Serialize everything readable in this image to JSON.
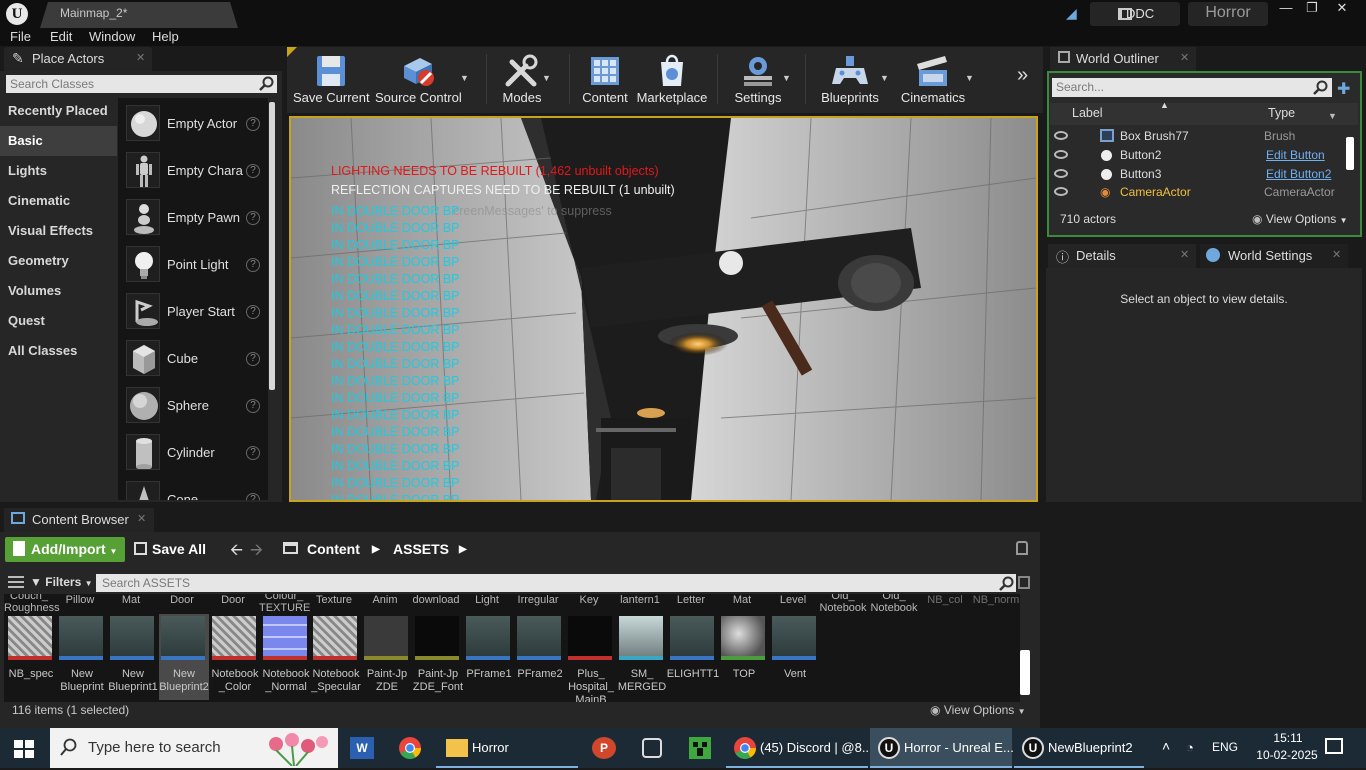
{
  "window": {
    "tab_title": "Mainmap_2*",
    "project_name": "Horror",
    "ddc_label": "DDC",
    "logo_letter": "U"
  },
  "menu": [
    "File",
    "Edit",
    "Window",
    "Help"
  ],
  "place_actors": {
    "tab_label": "Place Actors",
    "search_placeholder": "Search Classes",
    "categories": [
      "Recently Placed",
      "Basic",
      "Lights",
      "Cinematic",
      "Visual Effects",
      "Geometry",
      "Volumes",
      "Quest",
      "All Classes"
    ],
    "selected_category": "Basic",
    "actors": [
      "Empty Actor",
      "Empty Chara",
      "Empty Pawn",
      "Point Light",
      "Player Start",
      "Cube",
      "Sphere",
      "Cylinder",
      "Cone"
    ]
  },
  "toolbar": {
    "buttons": [
      {
        "label": "Save Current",
        "icon": "save-icon"
      },
      {
        "label": "Source Control",
        "icon": "source-control-icon"
      },
      {
        "label": "Modes",
        "icon": "modes-icon"
      },
      {
        "label": "Content",
        "icon": "content-icon"
      },
      {
        "label": "Marketplace",
        "icon": "marketplace-icon"
      },
      {
        "label": "Settings",
        "icon": "settings-icon"
      },
      {
        "label": "Blueprints",
        "icon": "blueprints-icon"
      },
      {
        "label": "Cinematics",
        "icon": "cinematics-icon"
      }
    ]
  },
  "viewport": {
    "lighting_warning": "LIGHTING NEEDS TO BE REBUILT (1,462 unbuilt objects)",
    "reflection_warning": "REFLECTION CAPTURES NEED TO BE REBUILT (1 unbuilt)",
    "ghost_text": "creenMessages' to suppress",
    "debug_message": "IN DOUBLE DOOR BP",
    "debug_count": 18,
    "warning_color": "#e0191b",
    "debug_color": "#1ecbe1",
    "border_color": "#c8a41b"
  },
  "world_outliner": {
    "tab_label": "World Outliner",
    "search_placeholder": "Search...",
    "col_label": "Label",
    "col_type": "Type",
    "rows": [
      {
        "label": "Box Brush77",
        "type": "Brush",
        "type_link": false
      },
      {
        "label": "Button2",
        "type": "Edit Button",
        "type_link": true
      },
      {
        "label": "Button3",
        "type": "Edit Button2",
        "type_link": true
      },
      {
        "label": "CameraActor",
        "type": "CameraActor",
        "type_link": false
      }
    ],
    "actor_count": "710 actors",
    "view_options": "View Options"
  },
  "details": {
    "tab_label": "Details",
    "world_settings_tab": "World Settings",
    "empty_message": "Select an object to view details."
  },
  "content_browser": {
    "tab_label": "Content Browser",
    "add_import": "Add/Import",
    "save_all": "Save All",
    "breadcrumb": [
      "Content",
      "ASSETS"
    ],
    "filters": "Filters",
    "search_placeholder": "Search ASSETS",
    "top_labels": [
      "Couch_\nRoughness",
      "Pillow",
      "Mat",
      "Door",
      "Door",
      "Colour_\nTEXTURE",
      "Texture",
      "Anim",
      "download",
      "Light",
      "Irregular",
      "Key",
      "lantern1",
      "Letter",
      "Mat",
      "Level",
      "Old_\nNotebook",
      "Old_\nNotebook",
      "NB_col",
      "NB_norm"
    ],
    "assets": [
      {
        "name": "NB_spec",
        "icon": "texture-icon",
        "bar": "#c0302c"
      },
      {
        "name": "New\nBlueprint",
        "icon": "blueprint-icon",
        "bar": "#3a75c4"
      },
      {
        "name": "New\nBlueprint1",
        "icon": "blueprint-icon",
        "bar": "#3a75c4"
      },
      {
        "name": "New\nBlueprint2",
        "icon": "blueprint-icon",
        "bar": "#3a75c4"
      },
      {
        "name": "Notebook\n_Color",
        "icon": "texture-icon",
        "bar": "#c0302c"
      },
      {
        "name": "Notebook\n_Normal",
        "icon": "texture-icon",
        "bar": "#c0302c"
      },
      {
        "name": "Notebook\n_Specular",
        "icon": "texture-icon",
        "bar": "#c0302c"
      },
      {
        "name": "Paint-Jp\nZDE",
        "icon": "font-icon",
        "bar": "#8a8a2c"
      },
      {
        "name": "Paint-Jp\nZDE_Font",
        "icon": "font-icon",
        "bar": "#8a8a2c"
      },
      {
        "name": "PFrame1",
        "icon": "blueprint-icon",
        "bar": "#3a75c4"
      },
      {
        "name": "PFrame2",
        "icon": "blueprint-icon",
        "bar": "#3a75c4"
      },
      {
        "name": "Plus_\nHospital_\nMainB",
        "icon": "texture-icon",
        "bar": "#c0302c"
      },
      {
        "name": "SM_\nMERGED",
        "icon": "mesh-icon",
        "bar": "#3aa7c4"
      },
      {
        "name": "ELIGHTT1",
        "icon": "blueprint-icon",
        "bar": "#3a75c4"
      },
      {
        "name": "TOP",
        "icon": "material-icon",
        "bar": "#4a9c3c"
      },
      {
        "name": "Vent",
        "icon": "blueprint-icon",
        "bar": "#3a75c4"
      }
    ],
    "selected_asset": "New\nBlueprint2",
    "item_count": "116 items (1 selected)",
    "view_options": "View Options"
  },
  "taskbar": {
    "search_placeholder": "Type here to search",
    "apps": [
      {
        "label": "",
        "icon": "word-icon"
      },
      {
        "label": "",
        "icon": "chrome-icon"
      },
      {
        "label": "Horror",
        "icon": "folder-icon"
      },
      {
        "label": "",
        "icon": "powerpoint-icon"
      },
      {
        "label": "",
        "icon": "epic-launcher-icon"
      },
      {
        "label": "",
        "icon": "minecraft-icon"
      },
      {
        "label": "(45) Discord | @8...",
        "icon": "chrome-icon"
      },
      {
        "label": "Horror - Unreal E...",
        "icon": "unreal-icon"
      },
      {
        "label": "NewBlueprint2",
        "icon": "unreal-icon"
      }
    ],
    "language": "ENG",
    "time": "15:11",
    "date": "10-02-2025"
  }
}
